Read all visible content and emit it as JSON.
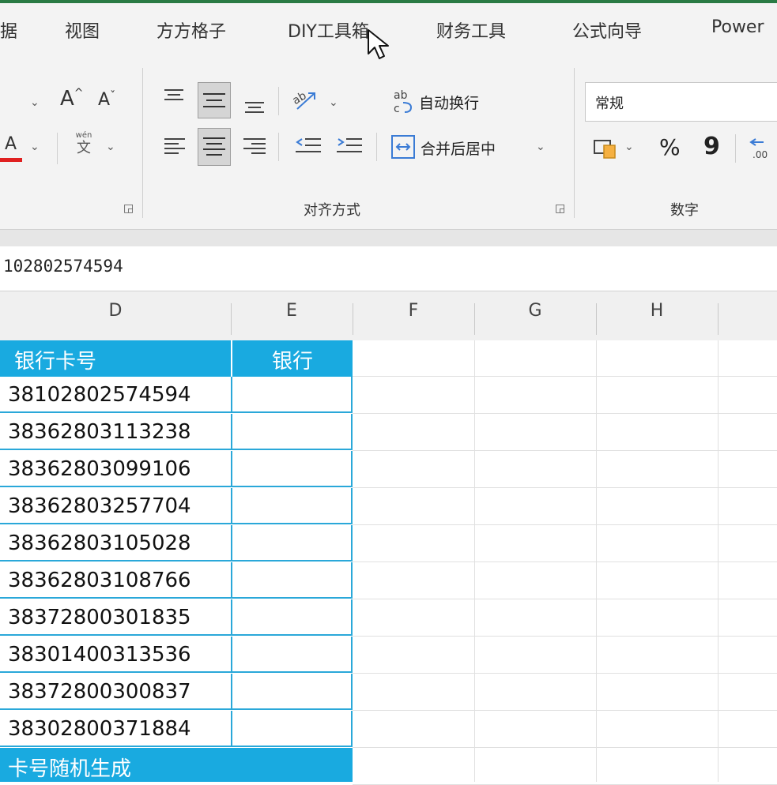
{
  "menu": {
    "tabs": [
      "据",
      "视图",
      "方方格子",
      "DIY工具箱",
      "财务工具",
      "公式向导",
      "Power"
    ]
  },
  "ribbon": {
    "font_grow": "A",
    "font_shrink": "A",
    "phonetic_top": "wén",
    "phonetic_bottom": "文",
    "wrap_text_label": "自动换行",
    "merge_center_label": "合并后居中",
    "alignment_group_label": "对齐方式",
    "number_format_value": "常规",
    "percent_symbol": "%",
    "comma_symbol": "9",
    "number_group_label": "数字"
  },
  "formula_bar": {
    "value": "102802574594"
  },
  "columns": [
    "D",
    "E",
    "F",
    "G",
    "H"
  ],
  "table": {
    "header_d": "银行卡号",
    "header_e": "银行",
    "rows": [
      "38102802574594",
      "38362803113238",
      "38362803099106",
      "38362803257704",
      "38362803105028",
      "38362803108766",
      "38372800301835",
      "38301400313536",
      "38372800300837",
      "38302800371884"
    ],
    "footer": "卡号随机生成"
  },
  "colors": {
    "accent": "#19aae0",
    "grid_border": "#2aa8d9",
    "ribbon_bg": "#f3f3f3",
    "font_color_bar": "#e02020"
  }
}
